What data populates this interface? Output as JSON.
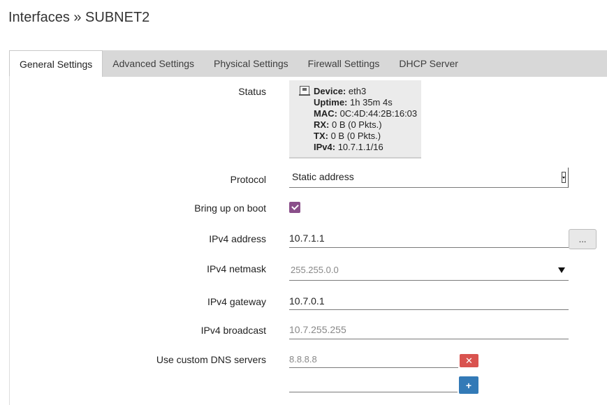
{
  "page": {
    "title": "Interfaces » SUBNET2"
  },
  "tabs": [
    {
      "label": "General Settings",
      "active": true
    },
    {
      "label": "Advanced Settings",
      "active": false
    },
    {
      "label": "Physical Settings",
      "active": false
    },
    {
      "label": "Firewall Settings",
      "active": false
    },
    {
      "label": "DHCP Server",
      "active": false
    }
  ],
  "status": {
    "label": "Status",
    "device_key": "Device:",
    "device_val": "eth3",
    "uptime_key": "Uptime:",
    "uptime_val": "1h 35m 4s",
    "mac_key": "MAC:",
    "mac_val": "0C:4D:44:2B:16:03",
    "rx_key": "RX:",
    "rx_val": "0 B (0 Pkts.)",
    "tx_key": "TX:",
    "tx_val": "0 B (0 Pkts.)",
    "ipv4_key": "IPv4:",
    "ipv4_val": "10.7.1.1/16"
  },
  "protocol": {
    "label": "Protocol",
    "value": "Static address"
  },
  "bringup": {
    "label": "Bring up on boot",
    "checked": true
  },
  "ipv4_address": {
    "label": "IPv4 address",
    "value": "10.7.1.1",
    "button": "..."
  },
  "ipv4_netmask": {
    "label": "IPv4 netmask",
    "placeholder": "255.255.0.0"
  },
  "ipv4_gateway": {
    "label": "IPv4 gateway",
    "value": "10.7.0.1"
  },
  "ipv4_broadcast": {
    "label": "IPv4 broadcast",
    "placeholder": "10.7.255.255"
  },
  "dns": {
    "label": "Use custom DNS servers",
    "placeholder": "8.8.8.8",
    "remove": "✕",
    "add": "+"
  },
  "colors": {
    "accent_checkbox": "#8a4f8a",
    "remove_button": "#d9534f",
    "add_button": "#337ab7"
  }
}
